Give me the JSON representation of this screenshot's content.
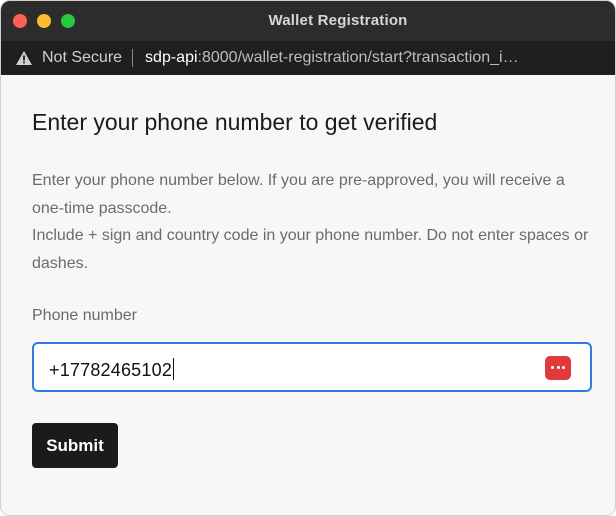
{
  "window": {
    "title": "Wallet Registration"
  },
  "address_bar": {
    "security_label": "Not Secure",
    "url_host": "sdp-api",
    "url_rest": ":8000/wallet-registration/start?transaction_i…"
  },
  "page": {
    "heading": "Enter your phone number to get verified",
    "description_line1": "Enter your phone number below. If you are pre-approved, you will receive a one-time passcode.",
    "description_line2": "Include + sign and country code in your phone number. Do not enter spaces or dashes.",
    "phone_label": "Phone number",
    "phone_value": "+17782465102",
    "submit_label": "Submit"
  },
  "colors": {
    "accent": "#2e7ae6",
    "button": "#1b1b1b",
    "password_manager_icon": "#e03a3a"
  },
  "icons": {
    "security": "warning-triangle-icon",
    "password_manager": "password-manager-icon"
  }
}
